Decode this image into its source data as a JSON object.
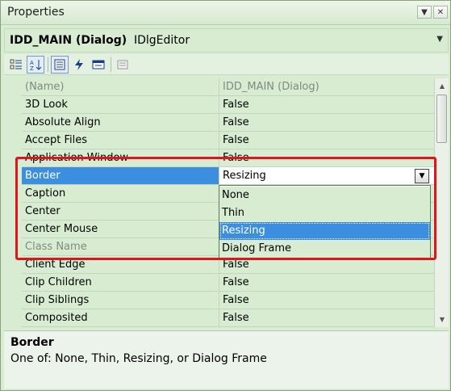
{
  "window": {
    "title": "Properties"
  },
  "object": {
    "name": "IDD_MAIN (Dialog)",
    "type": "IDlgEditor"
  },
  "toolbar": {
    "buttons": [
      {
        "icon": "categorized-icon"
      },
      {
        "icon": "alphabetical-icon"
      },
      {
        "icon": "properties-icon"
      },
      {
        "icon": "events-icon"
      },
      {
        "icon": "messages-icon"
      },
      {
        "icon": "property-pages-icon"
      }
    ]
  },
  "grid": {
    "rows": [
      {
        "name": "(Name)",
        "value": "IDD_MAIN (Dialog)"
      },
      {
        "name": "3D Look",
        "value": "False"
      },
      {
        "name": "Absolute Align",
        "value": "False"
      },
      {
        "name": "Accept Files",
        "value": "False"
      },
      {
        "name": "Application Window",
        "value": "False"
      },
      {
        "name": "Border",
        "value": "Resizing"
      },
      {
        "name": "Caption",
        "value": ""
      },
      {
        "name": "Center",
        "value": ""
      },
      {
        "name": "Center Mouse",
        "value": ""
      },
      {
        "name": "Class Name",
        "value": ""
      },
      {
        "name": "Client Edge",
        "value": "False"
      },
      {
        "name": "Clip Children",
        "value": "False"
      },
      {
        "name": "Clip Siblings",
        "value": "False"
      },
      {
        "name": "Composited",
        "value": "False"
      }
    ],
    "selected_row": "Border"
  },
  "dropdown": {
    "options": [
      "None",
      "Thin",
      "Resizing",
      "Dialog Frame"
    ],
    "highlighted": "Resizing"
  },
  "description": {
    "title": "Border",
    "text": "One of: None, Thin, Resizing, or Dialog Frame"
  },
  "colors": {
    "grid_background": "#d8ecd2",
    "selection": "#3b8ee0",
    "annotation_box": "#e0151b"
  }
}
